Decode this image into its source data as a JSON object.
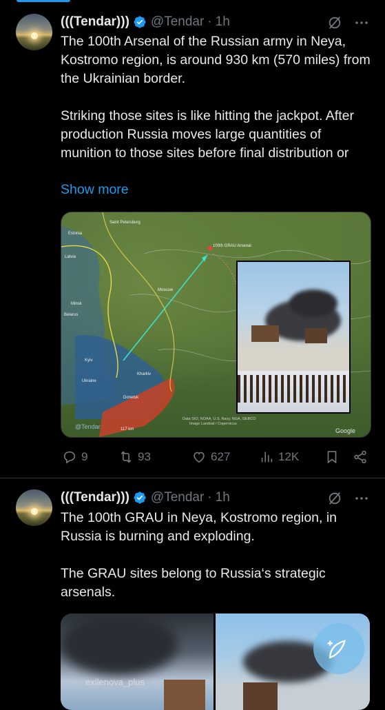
{
  "tweets": [
    {
      "author_name": "(((Tendar)))",
      "handle": "@Tendar",
      "separator": "·",
      "time": "1h",
      "text": "The 100th Arsenal of the Russian army in Neya, Kostromo region, is around 930 km (570 miles) from the Ukrainian border.\n\nStriking those sites is like hitting the jackpot. After production Russia moves large quantities of munition to those sites before final distribution or",
      "show_more": "Show more",
      "map_labels": {
        "arsenal": "100th GRAU Arsenal",
        "saint_petersburg": "Saint Petersburg",
        "estonia": "Estonia",
        "latvia": "Latvia",
        "belarus": "Belarus",
        "minsk": "Minsk",
        "moscow": "Moscow",
        "ukraine": "Ukraine",
        "kyiv": "Kyiv",
        "kharkiv": "Kharkiv",
        "donetsk": "Donetsk",
        "attribution": "Data SIO, NOAA, U.S. Navy, NGA, GEBCO",
        "attribution2": "Image Landsat / Copernicus",
        "watermark": "@Tendar",
        "scale": "117 km",
        "google": "Google"
      },
      "stats": {
        "replies": "9",
        "reposts": "93",
        "likes": "627",
        "views": "12K"
      }
    },
    {
      "author_name": "(((Tendar)))",
      "handle": "@Tendar",
      "separator": "·",
      "time": "1h",
      "text": "The 100th GRAU in Neya, Kostromo region, in Russia is burning and exploding.\n\nThe GRAU sites belong to Russia‘s strategic arsenals.",
      "photo_watermark": "exilenova_plus"
    }
  ],
  "colors": {
    "accent": "#1d9bf0",
    "muted": "#71767b",
    "text": "#e7e9ea",
    "background": "#000000"
  },
  "icons": [
    "verified-badge-icon",
    "grok-icon",
    "more-icon",
    "reply-icon",
    "repost-icon",
    "like-icon",
    "views-icon",
    "bookmark-icon",
    "share-icon",
    "compose-icon"
  ]
}
